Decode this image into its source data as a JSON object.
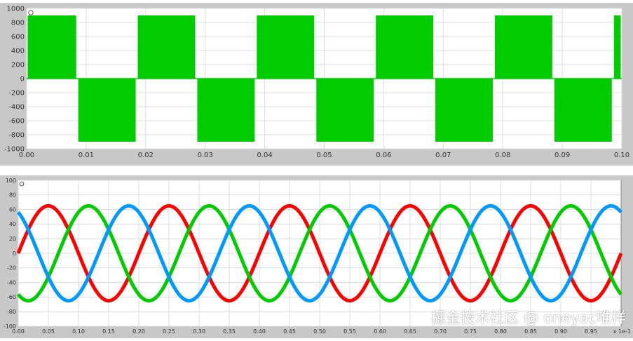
{
  "chart_data": [
    {
      "type": "line",
      "title": "",
      "xlabel": "",
      "ylabel": "",
      "xlim": [
        0,
        0.1
      ],
      "ylim": [
        -1000,
        1000
      ],
      "x_ticks": [
        "0.00",
        "0.01",
        "0.02",
        "0.03",
        "0.04",
        "0.05",
        "0.06",
        "0.07",
        "0.08",
        "0.09",
        "0.10"
      ],
      "y_ticks": [
        "1000",
        "800",
        "600",
        "400",
        "200",
        "0",
        "-200",
        "-400",
        "-600",
        "-800",
        "-1000"
      ],
      "grid": true,
      "series": [
        {
          "color": "#00cc00",
          "description_values": "PWM pulse train switching between 0 and ±900",
          "segments": [
            {
              "x0": 0.0,
              "x1": 0.0085,
              "y_low": 0,
              "y_high": 900
            },
            {
              "x0": 0.0085,
              "x1": 0.0185,
              "y_low": -900,
              "y_high": 0
            },
            {
              "x0": 0.0185,
              "x1": 0.0285,
              "y_low": 0,
              "y_high": 900
            },
            {
              "x0": 0.0285,
              "x1": 0.0385,
              "y_low": -900,
              "y_high": 0
            },
            {
              "x0": 0.0385,
              "x1": 0.0485,
              "y_low": 0,
              "y_high": 900
            },
            {
              "x0": 0.0485,
              "x1": 0.0585,
              "y_low": -900,
              "y_high": 0
            },
            {
              "x0": 0.0585,
              "x1": 0.0685,
              "y_low": 0,
              "y_high": 900
            },
            {
              "x0": 0.0685,
              "x1": 0.0785,
              "y_low": -900,
              "y_high": 0
            },
            {
              "x0": 0.0785,
              "x1": 0.0885,
              "y_low": 0,
              "y_high": 900
            },
            {
              "x0": 0.0885,
              "x1": 0.0985,
              "y_low": -900,
              "y_high": 0
            },
            {
              "x0": 0.0985,
              "x1": 0.1,
              "y_low": 0,
              "y_high": 900
            }
          ]
        }
      ]
    },
    {
      "type": "line",
      "title": "",
      "xlabel": "",
      "ylabel": "",
      "xlim": [
        0,
        1.0
      ],
      "ylim": [
        -100,
        100
      ],
      "x_ticks": [
        "0.00",
        "0.05",
        "0.10",
        "0.15",
        "0.20",
        "0.25",
        "0.30",
        "0.35",
        "0.40",
        "0.45",
        "0.50",
        "0.55",
        "0.60",
        "0.65",
        "0.70",
        "0.75",
        "0.80",
        "0.85",
        "0.90",
        "0.95"
      ],
      "x_scale_note": "x 1e-1",
      "y_ticks": [
        "100",
        "80",
        "60",
        "40",
        "20",
        "0",
        "-20",
        "-40",
        "-60",
        "-80",
        "-100"
      ],
      "grid": true,
      "period": 0.2,
      "series": [
        {
          "color": "#ff0000",
          "amplitude": 65,
          "phase_deg": 0
        },
        {
          "color": "#00cc00",
          "amplitude": 65,
          "phase_deg": -120
        },
        {
          "color": "#0099ff",
          "amplitude": 65,
          "phase_deg": 120
        }
      ]
    }
  ],
  "watermark": "掘金技术社区 @ oneyac唯样"
}
